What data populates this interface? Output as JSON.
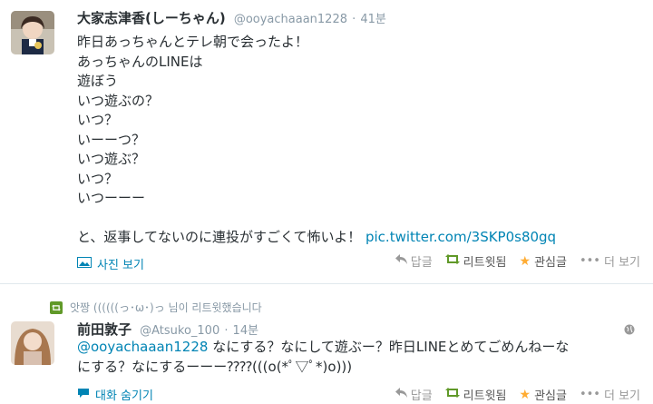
{
  "colors": {
    "link": "#0084b4",
    "retweet_green": "#609928",
    "favorite_orange": "#ffac33",
    "muted": "#8899a6"
  },
  "tweets": [
    {
      "fullname": "大家志津香(しーちゃん)",
      "username": "@ooyachaaan1228",
      "dot": "·",
      "time": "41분",
      "text_lines": [
        "昨日あっちゃんとテレ朝で会ったよ！",
        "あっちゃんのLINEは",
        "遊ぼう",
        "いつ遊ぶの？",
        "いつ？",
        "いーーつ？",
        "いつ遊ぶ？",
        "いつ？",
        "いつーーー",
        "",
        "と、返事してないのに連投がすごくて怖いよ！"
      ],
      "link": "pic.twitter.com/3SKP0s80gq",
      "expand_label": "사진 보기",
      "expand_icon": "photo-icon",
      "actions": {
        "reply": "답글",
        "retweet": "리트윗됨",
        "favorite": "관심글",
        "more": "더 보기"
      }
    },
    {
      "context": "앗짱 ((((((っ･ω･)っ 님이 리트윗했습니다",
      "fullname": "前田敦子",
      "username": "@Atsuko_100",
      "dot": "·",
      "time": "14분",
      "mention": "@ooyachaaan1228",
      "text_line1": " なにする？なにして遊ぶー？昨日LINEとめてごめんねーな",
      "text_line2": "にする？なにするーーー⁇⁇(((o(*ﾟ▽ﾟ*)o)))",
      "expand_label": "대화 숨기기",
      "expand_icon": "conversation-icon",
      "actions": {
        "reply": "답글",
        "retweet": "리트윗됨",
        "favorite": "관심글",
        "more": "더 보기"
      }
    }
  ]
}
